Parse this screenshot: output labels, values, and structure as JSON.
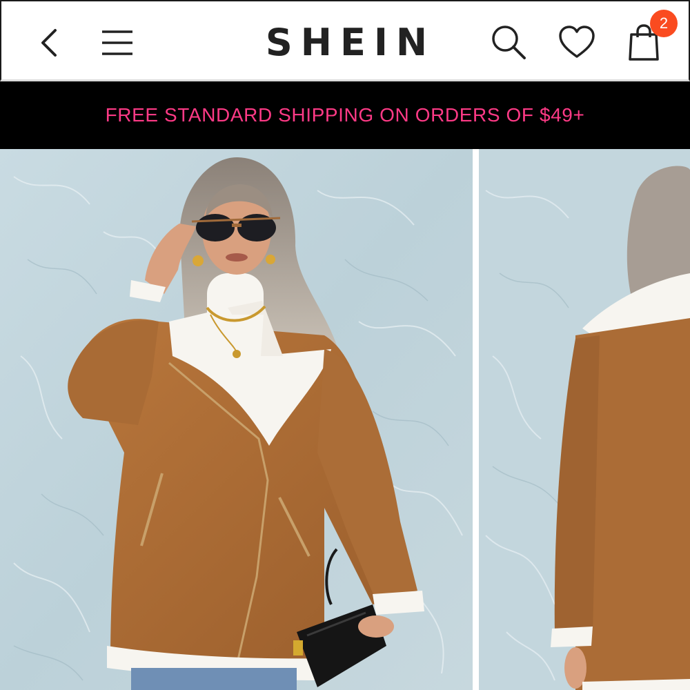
{
  "header": {
    "brand": "SHEIN",
    "cart_count": "2",
    "icons": {
      "back": "chevron-left-icon",
      "menu": "hamburger-menu-icon",
      "search": "search-icon",
      "wishlist": "heart-icon",
      "cart": "shopping-bag-icon"
    }
  },
  "promo_banner": {
    "text": "FREE STANDARD SHIPPING ON ORDERS OF $49+"
  },
  "gallery": {
    "images": [
      {
        "name": "product-photo-front",
        "alt": "Model wearing brown suede shearling-lined zip jacket, front view"
      },
      {
        "name": "product-photo-back",
        "alt": "Brown suede shearling-lined zip jacket, back view"
      }
    ]
  },
  "colors": {
    "promo_text": "#ff3a86",
    "promo_bg": "#000000",
    "badge": "#fa4b20",
    "jacket": "#a86a34",
    "wall": "#c4d6dd"
  }
}
